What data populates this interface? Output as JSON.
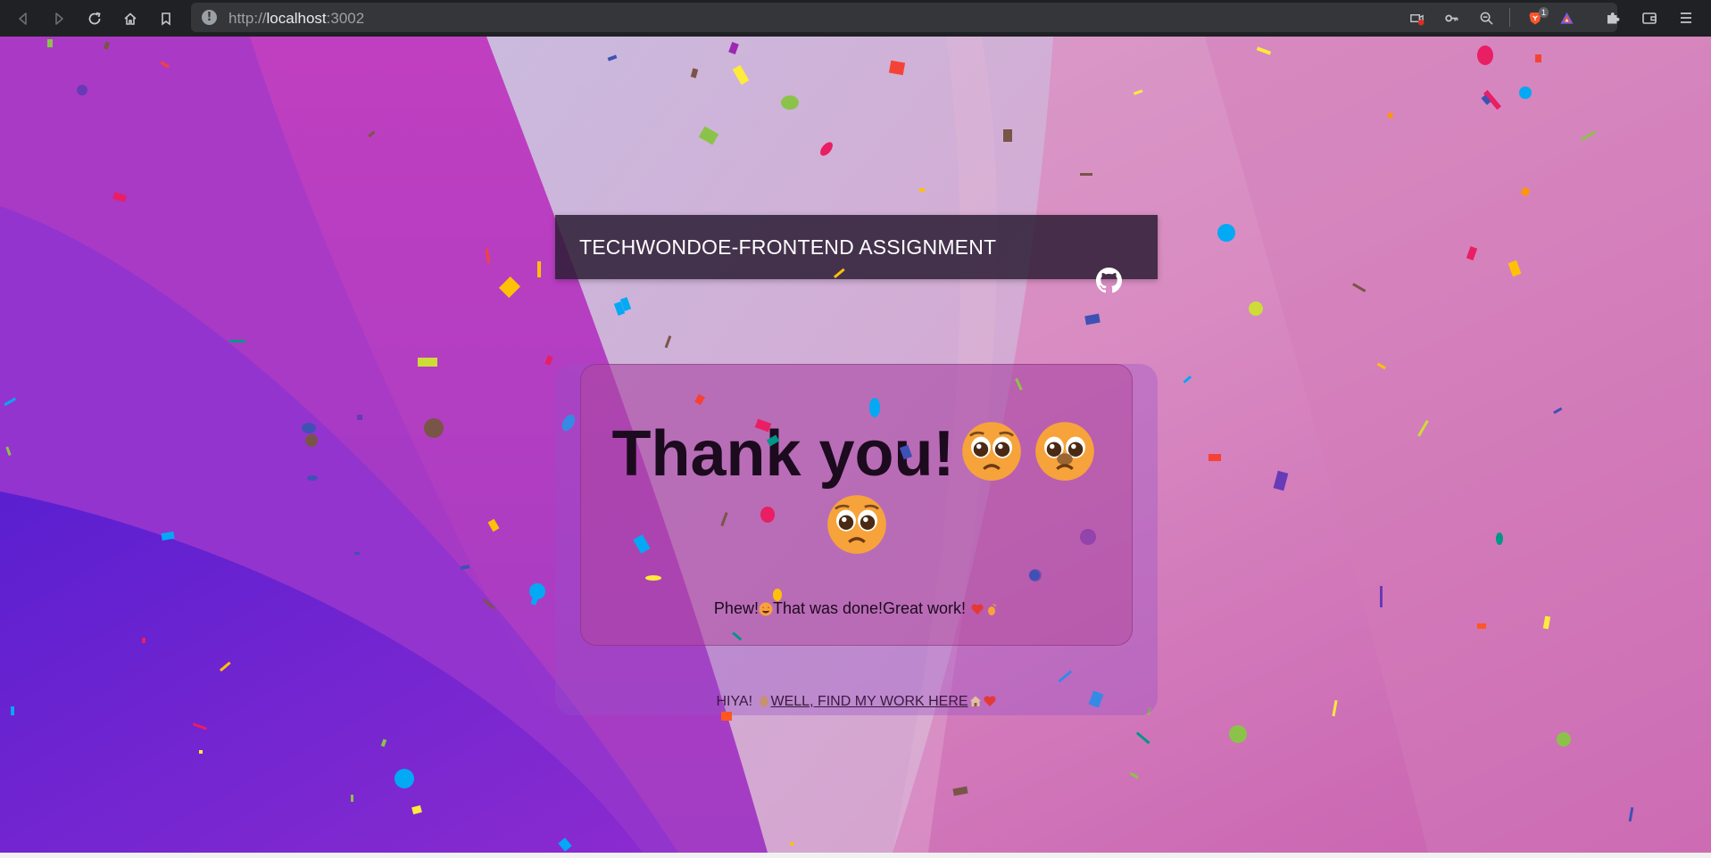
{
  "browser": {
    "url_scheme": "http://",
    "url_host": "localhost",
    "url_port": ":3002",
    "brave_badge_count": "1"
  },
  "header": {
    "title": "TECHWONDOE-FRONTEND ASSIGNMENT",
    "github_icon": "github-icon"
  },
  "card": {
    "title": "Thank you!",
    "title_emoji": "pleading-face-emoji",
    "subtitle_before": "Phew!",
    "subtitle_middle": "That was done!Great work!",
    "footer_prefix": "HIYA!",
    "footer_link": "WELL, FIND MY WORK HERE"
  },
  "colors": {
    "chrome_bg": "#202124",
    "urlbar_bg": "#35363a",
    "header_bg": "#2b1c34",
    "text_dark": "#1c0a1e"
  }
}
